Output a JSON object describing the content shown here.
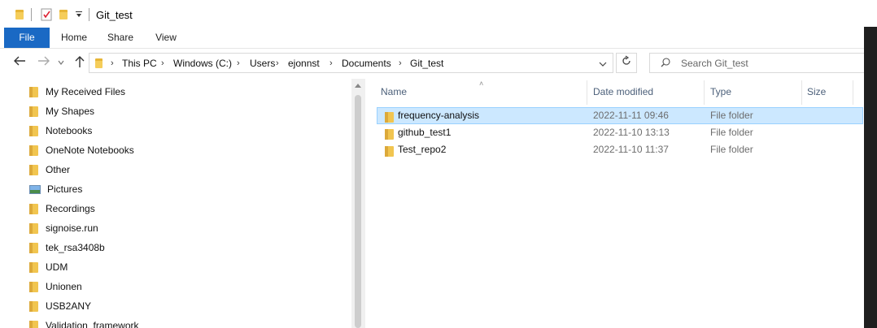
{
  "window": {
    "title": "Git_test"
  },
  "ribbon": {
    "tabs": [
      "File",
      "Home",
      "Share",
      "View"
    ]
  },
  "address": {
    "crumbs": [
      "This PC",
      "Windows (C:)",
      "Users",
      "ejonnst",
      "Documents",
      "Git_test"
    ]
  },
  "search": {
    "placeholder": "Search Git_test"
  },
  "nav_pane": {
    "items": [
      {
        "label": "My Received Files",
        "icon": "folder-icon"
      },
      {
        "label": "My Shapes",
        "icon": "folder-icon"
      },
      {
        "label": "Notebooks",
        "icon": "folder-icon"
      },
      {
        "label": "OneNote Notebooks",
        "icon": "folder-icon"
      },
      {
        "label": "Other",
        "icon": "folder-icon"
      },
      {
        "label": "Pictures",
        "icon": "pictures-icon"
      },
      {
        "label": "Recordings",
        "icon": "folder-icon"
      },
      {
        "label": "signoise.run",
        "icon": "folder-icon"
      },
      {
        "label": "tek_rsa3408b",
        "icon": "folder-icon"
      },
      {
        "label": "UDM",
        "icon": "folder-icon"
      },
      {
        "label": "Unionen",
        "icon": "folder-icon"
      },
      {
        "label": "USB2ANY",
        "icon": "folder-icon"
      },
      {
        "label": "Validation_framework",
        "icon": "folder-icon"
      }
    ]
  },
  "file_list": {
    "columns": [
      "Name",
      "Date modified",
      "Type",
      "Size"
    ],
    "rows": [
      {
        "name": "frequency-analysis",
        "date": "2022-11-11 09:46",
        "type": "File folder",
        "selected": true
      },
      {
        "name": "github_test1",
        "date": "2022-11-10 13:13",
        "type": "File folder",
        "selected": false
      },
      {
        "name": "Test_repo2",
        "date": "2022-11-10 11:37",
        "type": "File folder",
        "selected": false
      }
    ]
  },
  "colors": {
    "accent": "#1a69c4",
    "selection": "#cce8ff",
    "selection_border": "#99d1ff"
  }
}
